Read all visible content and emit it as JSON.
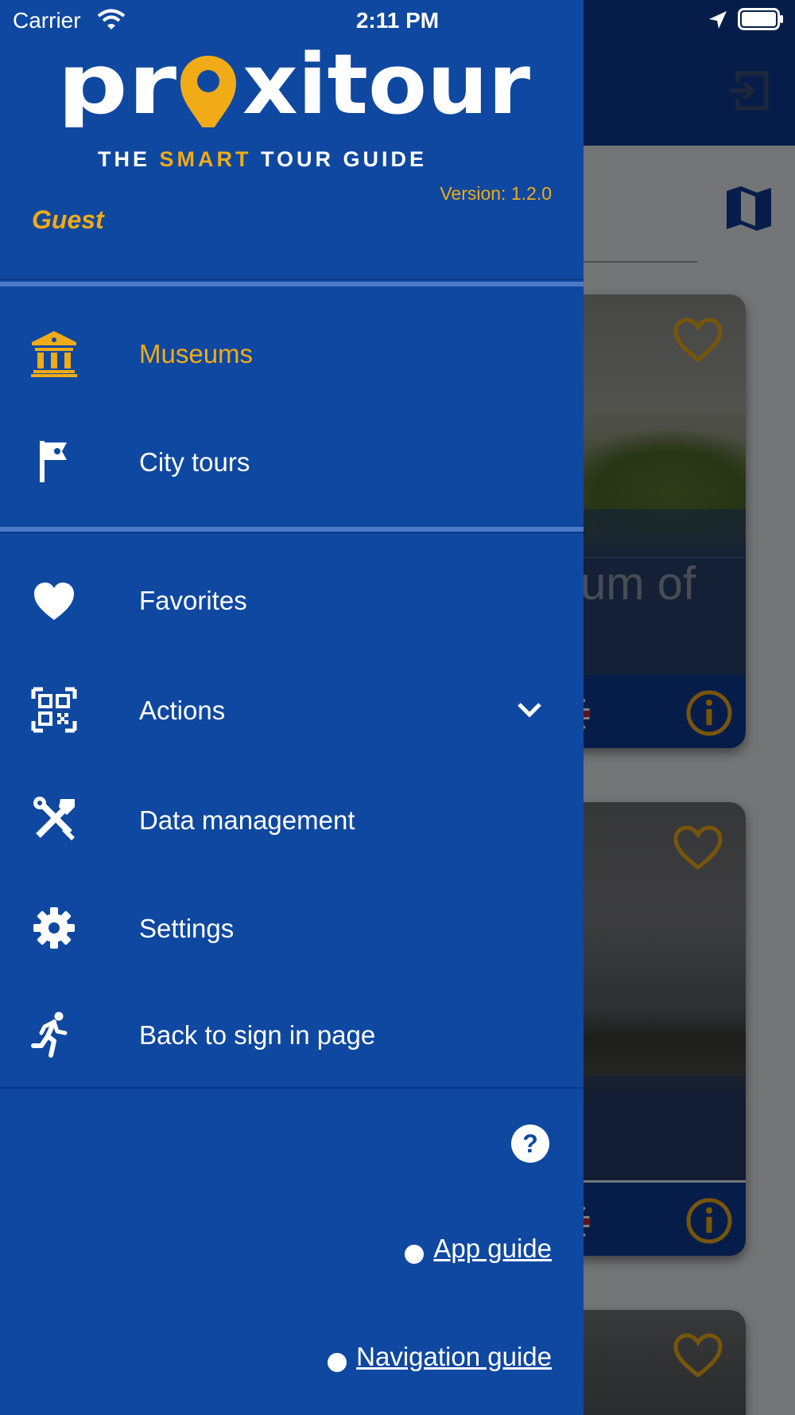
{
  "status_bar": {
    "carrier": "Carrier",
    "time": "2:11 PM"
  },
  "drawer": {
    "logo_text": "proxitour",
    "tagline_pre": "THE ",
    "tagline_accent": "SMART",
    "tagline_post": " TOUR GUIDE",
    "version": "Version: 1.2.0",
    "user": "Guest",
    "primary_items": [
      {
        "label": "Museums",
        "icon": "museum-icon",
        "active": true
      },
      {
        "label": "City tours",
        "icon": "flag-icon",
        "active": false
      }
    ],
    "secondary_items": [
      {
        "label": "Favorites",
        "icon": "heart-icon"
      },
      {
        "label": "Actions",
        "icon": "qr-code-icon",
        "expandable": true
      },
      {
        "label": "Data management",
        "icon": "tools-icon"
      },
      {
        "label": "Settings",
        "icon": "gear-icon"
      },
      {
        "label": "Back to sign in page",
        "icon": "running-person-icon"
      }
    ],
    "links": {
      "app_guide": "App guide",
      "navigation_guide": "Navigation guide"
    }
  },
  "background": {
    "card_title_fragment": "um of"
  },
  "colors": {
    "drawer_bg": "#0f48a0",
    "accent": "#f0ab17",
    "header_bg": "#0e3a92",
    "text": "#ffffff"
  }
}
